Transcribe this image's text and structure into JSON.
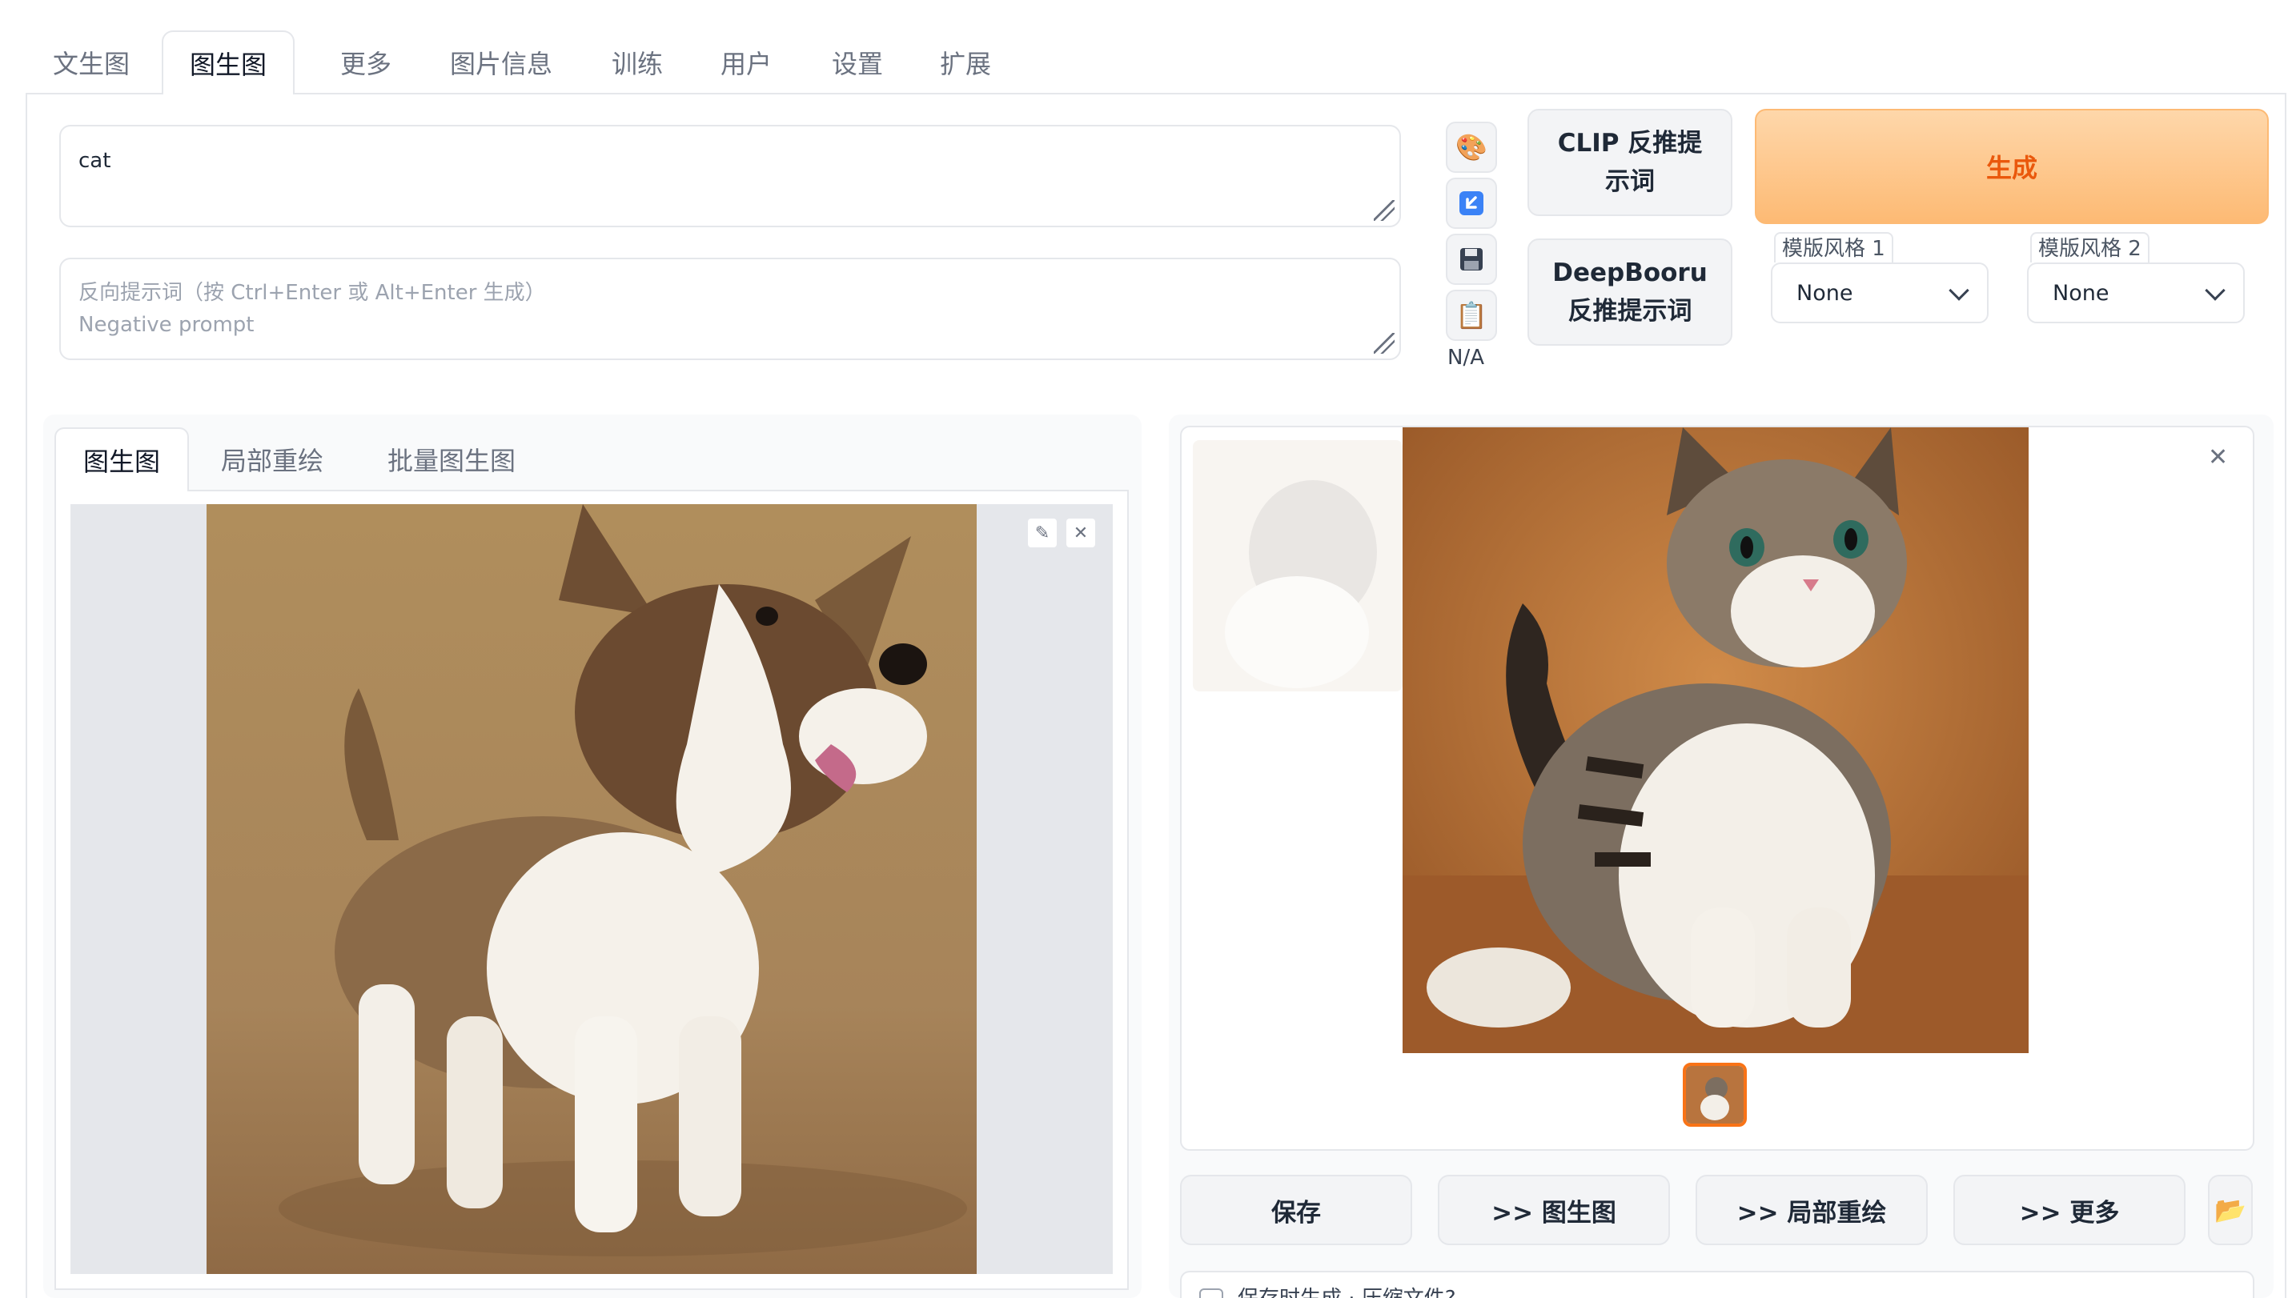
{
  "top_tabs": [
    "文生图",
    "图生图",
    "更多",
    "图片信息",
    "训练",
    "用户",
    "设置",
    "扩展"
  ],
  "active_top_tab": "图生图",
  "prompt": {
    "value": "cat",
    "negative_placeholder_line1": "反向提示词（按 Ctrl+Enter 或 Alt+Enter 生成）",
    "negative_placeholder_line2": "Negative prompt"
  },
  "tools": {
    "icons": [
      "palette-icon",
      "arrow-icon",
      "save-icon",
      "clipboard-icon"
    ],
    "token_counter": "N/A"
  },
  "buttons": {
    "clip_line1": "CLIP 反推提",
    "clip_line2": "示词",
    "deepbooru_line1": "DeepBooru",
    "deepbooru_line2": "反推提示词",
    "generate": "生成"
  },
  "styles": {
    "label1": "模版风格 1",
    "value1": "None",
    "label2": "模版风格 2",
    "value2": "None"
  },
  "sub_tabs": [
    "图生图",
    "局部重绘",
    "批量图生图"
  ],
  "active_sub_tab": "图生图",
  "output_actions": [
    "保存",
    ">> 图生图",
    ">> 局部重绘",
    ">> 更多"
  ],
  "zip_option": "保存时生成 · 压缩文件?",
  "colors": {
    "accent": "#f97316",
    "generate_bg": "#fdba74",
    "generate_text": "#ea580c",
    "border": "#e5e7eb"
  }
}
